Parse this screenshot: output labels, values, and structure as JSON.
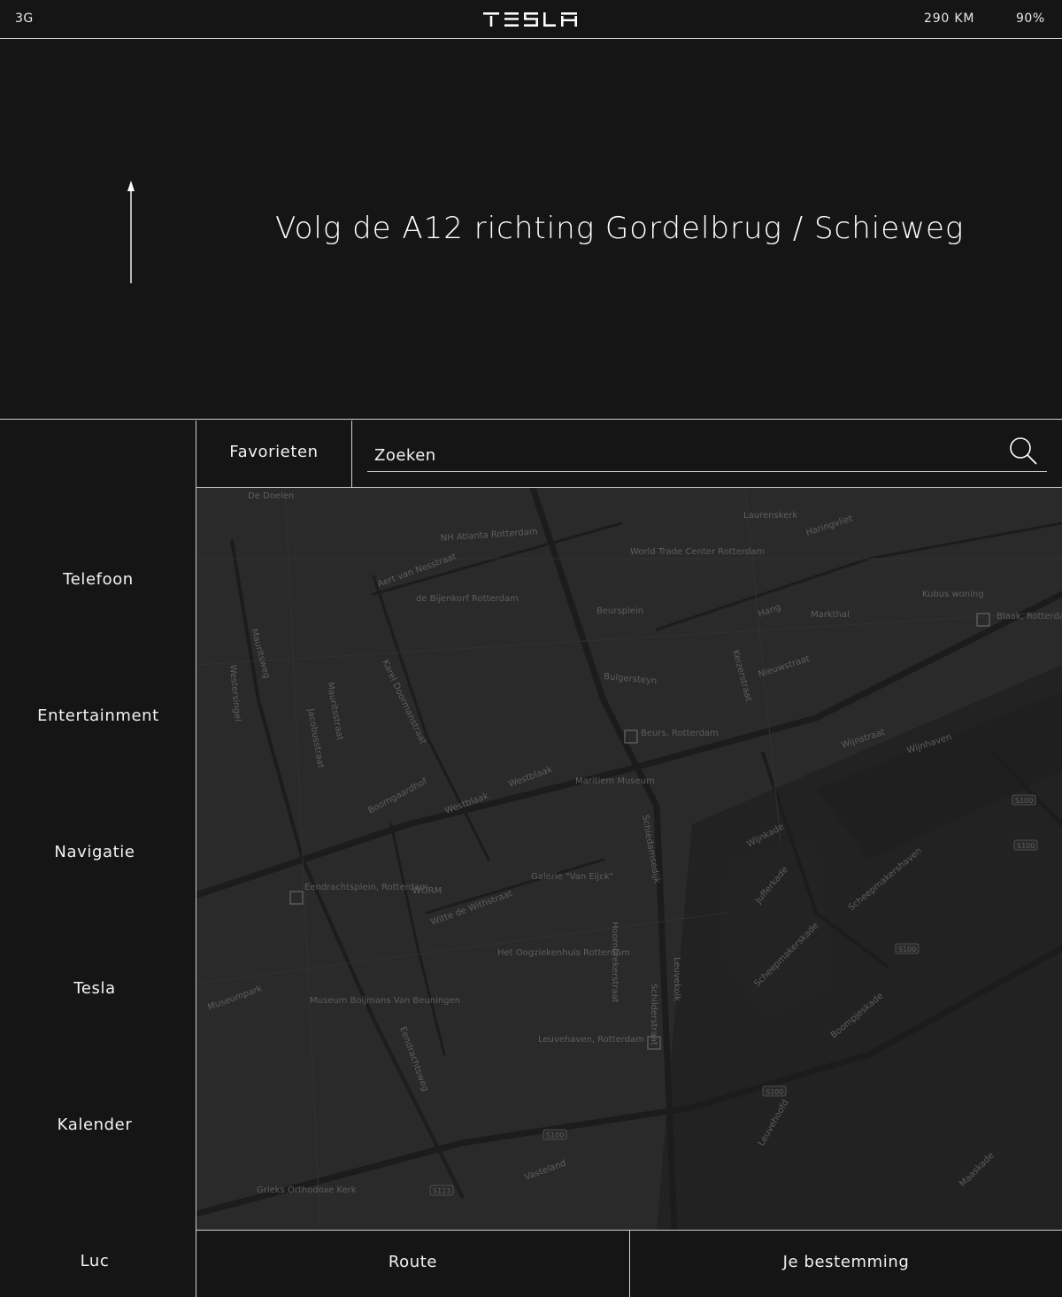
{
  "status_bar": {
    "network": "3G",
    "brand": "TESLA",
    "range": "290 KM",
    "battery": "90%"
  },
  "instruction": {
    "text": "Volg de A12 richting Gordelbrug / Schieweg",
    "arrow_icon": "straight-arrow-up-icon"
  },
  "sidebar": {
    "items": [
      {
        "label": "Telefoon"
      },
      {
        "label": "Entertainment"
      },
      {
        "label": "Navigatie"
      },
      {
        "label": "Tesla"
      },
      {
        "label": "Kalender"
      },
      {
        "label": "Luc"
      }
    ]
  },
  "tabs": {
    "favorites_label": "Favorieten"
  },
  "search": {
    "placeholder": "Zoeken",
    "icon": "search-icon"
  },
  "map": {
    "labels": [
      "De Doelen",
      "NH Atlanta Rotterdam",
      "World Trade Center Rotterdam",
      "Laurenskerk",
      "Aert van Nesstraat",
      "de Bijenkorf Rotterdam",
      "Beursplein",
      "Hang",
      "Markthal",
      "Kubus woning",
      "Blaak, Rotterdam",
      "Bulgersteyn",
      "Keizerstraat",
      "Nieuwstraat",
      "Mauritsweg",
      "Westersingel",
      "Karel Doormanstraat",
      "Mauritsstraat",
      "Jacobusstraat",
      "Beurs, Rotterdam",
      "Wijnstraat",
      "Wijnhaven",
      "Boomgaardhof",
      "Westblaak",
      "Maritiem Museum",
      "Wijnkade",
      "Eendrachtsplein, Rotterdam",
      "WORM",
      "Galerie \"Van Eijck\"",
      "Witte de Withstraat",
      "Jufferkade",
      "Scheepmakershaven",
      "Het Oogziekenhuis Rotterdam",
      "Museumpark",
      "Museum Boijmans Van Beuningen",
      "Leuvehaven, Rotterdam",
      "Hoornbrekerstraat",
      "Scheepmakerskade",
      "Boompjeskade",
      "Grieks Orthodoxe Kerk",
      "Vasteland",
      "Leuvehoofd",
      "Maaskade",
      "Schilderstraat",
      "Haringvliet",
      "Leuvekolk",
      "Eendrachtsweg",
      "Schiedamsedijk",
      "Westblaak"
    ],
    "road_shields": [
      "S100",
      "S100",
      "S100",
      "S100",
      "S100",
      "S123"
    ]
  },
  "bottom": {
    "route_label": "Route",
    "destination_label": "Je bestemming"
  }
}
